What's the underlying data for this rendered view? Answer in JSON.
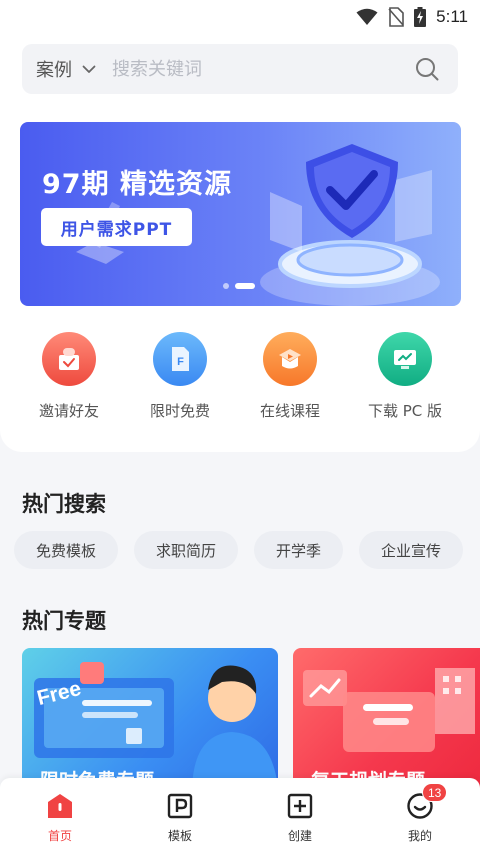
{
  "status_bar": {
    "time": "5:11"
  },
  "search": {
    "category": "案例",
    "placeholder": "搜索关键词"
  },
  "banner": {
    "title": "97期 精选资源",
    "button_label": "用户需求PPT",
    "page_count": 2,
    "active_page": 2
  },
  "quick_actions": [
    {
      "label": "邀请好友",
      "icon": "gift-box-icon",
      "color": "#f25a4b"
    },
    {
      "label": "限时免费",
      "icon": "file-f-icon",
      "color": "#3f94f4"
    },
    {
      "label": "在线课程",
      "icon": "play-course-icon",
      "color": "#fb8a2e"
    },
    {
      "label": "下载 PC 版",
      "icon": "monitor-icon",
      "color": "#16b88e"
    }
  ],
  "hot_search": {
    "title": "热门搜索",
    "tags": [
      "免费模板",
      "求职简历",
      "开学季",
      "企业宣传"
    ]
  },
  "hot_topics": {
    "title": "热门专题",
    "cards": [
      {
        "title": "限时免费专题",
        "badge": "Free"
      },
      {
        "title": "复工规划专题"
      }
    ]
  },
  "bottom_nav": {
    "items": [
      {
        "label": "首页",
        "icon": "home-icon",
        "active": true
      },
      {
        "label": "模板",
        "icon": "template-p-icon"
      },
      {
        "label": "创建",
        "icon": "create-plus-icon"
      },
      {
        "label": "我的",
        "icon": "profile-icon"
      }
    ],
    "profile_badge": "13"
  },
  "colors": {
    "accent_red": "#f04343",
    "banner_blue": "#4a5cf0"
  }
}
